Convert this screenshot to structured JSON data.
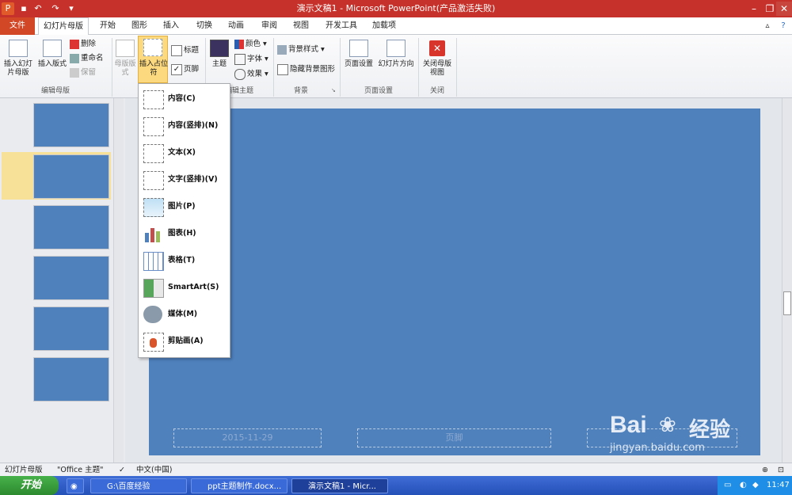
{
  "window": {
    "title": "演示文稿1 - Microsoft PowerPoint(产品激活失败)"
  },
  "tabs": [
    {
      "label": "文件"
    },
    {
      "label": "幻灯片母版"
    },
    {
      "label": "开始"
    },
    {
      "label": "图形"
    },
    {
      "label": "插入"
    },
    {
      "label": "切换"
    },
    {
      "label": "动画"
    },
    {
      "label": "审阅"
    },
    {
      "label": "视图"
    },
    {
      "label": "开发工具"
    },
    {
      "label": "加载项"
    }
  ],
  "ribbon": {
    "edit_master": {
      "name": "编辑母版",
      "insert_slide_master": "插入幻灯片母版",
      "insert_layout": "插入版式",
      "delete": "删除",
      "rename": "重命名",
      "preserve": "保留"
    },
    "master_layout": {
      "name": "母版版式",
      "master_layout_btn": "母版版式",
      "insert_placeholder": "插入占位符",
      "title_cb": "标题",
      "footer_cb": "页脚"
    },
    "edit_theme": {
      "name": "编辑主题",
      "themes": "主题",
      "colors": "颜色",
      "fonts": "字体",
      "effects": "效果"
    },
    "background": {
      "name": "背景",
      "bg_styles": "背景样式",
      "hide_bg": "隐藏背景图形"
    },
    "page_setup": {
      "name": "页面设置",
      "page_setup_btn": "页面设置",
      "orientation": "幻灯片方向"
    },
    "close": {
      "name": "关闭",
      "close_master": "关闭母版视图"
    }
  },
  "dropdown": {
    "items": [
      {
        "label": "内容(C)"
      },
      {
        "label": "内容(竖排)(N)"
      },
      {
        "label": "文本(X)"
      },
      {
        "label": "文字(竖排)(V)"
      },
      {
        "label": "图片(P)"
      },
      {
        "label": "图表(H)"
      },
      {
        "label": "表格(T)"
      },
      {
        "label": "SmartArt(S)"
      },
      {
        "label": "媒体(M)"
      },
      {
        "label": "剪贴画(A)"
      }
    ]
  },
  "slide": {
    "date_placeholder": "2015-11-29",
    "footer_placeholder": "页脚"
  },
  "status": {
    "view": "幻灯片母版",
    "theme": "\"Office 主题\"",
    "language": "中文(中国)"
  },
  "taskbar": {
    "start": "开始",
    "tasks": [
      {
        "label": "G:\\百度经验"
      },
      {
        "label": "ppt主题制作.docx..."
      },
      {
        "label": "演示文稿1 - Micr..."
      }
    ],
    "clock": "11:47"
  },
  "watermark": {
    "brand": "Bai",
    "cn": "经验",
    "url": "jingyan.baidu.com"
  },
  "colors": {
    "title_bar": "#c6322b",
    "file_tab": "#d24726",
    "slide_bg": "#4f81bd",
    "taskbar": "#2451b8"
  }
}
